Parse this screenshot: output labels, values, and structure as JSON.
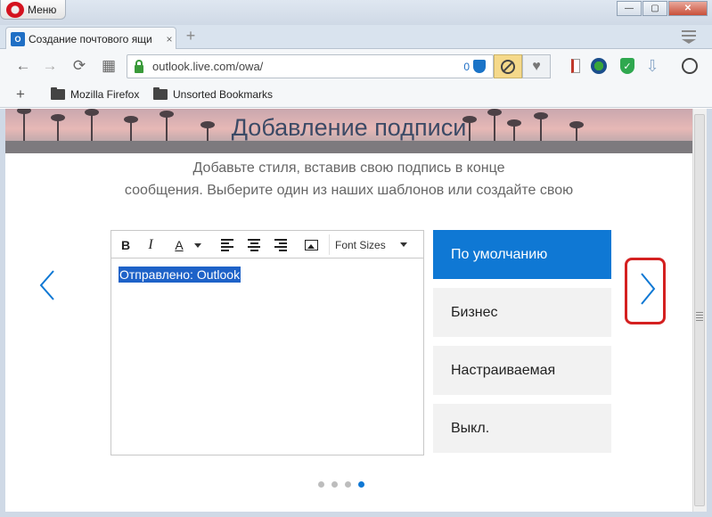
{
  "window": {
    "menu_label": "Меню",
    "controls": {
      "minimize": "—",
      "maximize": "▢",
      "close": "✕"
    }
  },
  "tab": {
    "icon_text": "O",
    "title": "Создание почтового ящи",
    "close": "×",
    "new_tab": "+"
  },
  "navigation": {
    "back": "←",
    "forward": "→",
    "reload": "⟳",
    "speed_dial": "▦"
  },
  "address_bar": {
    "url": "outlook.live.com/owa/",
    "tracker_count": "0"
  },
  "extensions": {
    "heart": "♥",
    "download": "⇩"
  },
  "bookmarks": {
    "add": "+",
    "items": [
      {
        "label": "Mozilla Firefox"
      },
      {
        "label": "Unsorted Bookmarks"
      }
    ]
  },
  "page": {
    "title": "Добавление подписи",
    "subtitle_line1": "Добавьте стиля, вставив свою подпись в конце",
    "subtitle_line2": "сообщения. Выберите один из наших шаблонов или создайте свою",
    "editor": {
      "bold": "B",
      "italic": "I",
      "font_color": "A",
      "font_sizes_label": "Font Sizes",
      "signature_text": "Отправлено: Outlook"
    },
    "templates": [
      {
        "label": "По умолчанию",
        "selected": true
      },
      {
        "label": "Бизнес",
        "selected": false
      },
      {
        "label": "Настраиваемая",
        "selected": false
      },
      {
        "label": "Выкл.",
        "selected": false
      }
    ],
    "pager": {
      "total": 4,
      "current": 4
    },
    "colors": {
      "accent": "#0f78d4",
      "highlight": "#d42020"
    }
  }
}
